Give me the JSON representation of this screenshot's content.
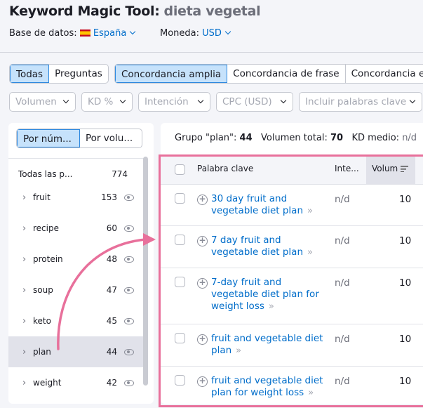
{
  "header": {
    "title": "Keyword Magic Tool:",
    "query": "dieta vegetal",
    "db_label": "Base de datos:",
    "db_value": "España",
    "currency_label": "Moneda:",
    "currency_value": "USD"
  },
  "tabs_type": [
    {
      "label": "Todas",
      "active": true
    },
    {
      "label": "Preguntas",
      "active": false
    }
  ],
  "tabs_match": [
    {
      "label": "Concordancia amplia",
      "active": true
    },
    {
      "label": "Concordancia de frase",
      "active": false
    },
    {
      "label": "Concordancia exacta",
      "active": false
    }
  ],
  "filters": [
    "Volumen",
    "KD %",
    "Intención",
    "CPC (USD)",
    "Incluir palabras clave"
  ],
  "groups": {
    "sort_tabs": [
      "Por núm...",
      "Por volu..."
    ],
    "all_label": "Todas las p...",
    "all_count": "774",
    "items": [
      {
        "name": "fruit",
        "count": "153"
      },
      {
        "name": "recipe",
        "count": "60"
      },
      {
        "name": "protein",
        "count": "48"
      },
      {
        "name": "soup",
        "count": "47"
      },
      {
        "name": "keto",
        "count": "45"
      },
      {
        "name": "plan",
        "count": "44",
        "selected": true
      },
      {
        "name": "weight",
        "count": "42"
      }
    ]
  },
  "summary": {
    "group_label": "Grupo \"plan\":",
    "group_count": "44",
    "total_label": "Volumen total:",
    "total_value": "70",
    "kd_label": "KD medio:",
    "kd_value": "n/d"
  },
  "table": {
    "headers": {
      "keyword": "Palabra clave",
      "intent": "Inte...",
      "volume": "Volum"
    },
    "rows": [
      {
        "keyword": "30 day fruit and vegetable diet plan",
        "intent": "n/d",
        "volume": "10"
      },
      {
        "keyword": "7 day fruit and vegetable diet plan",
        "intent": "n/d",
        "volume": "10"
      },
      {
        "keyword": "7-day fruit and vegetable diet plan for weight loss",
        "intent": "n/d",
        "volume": "10"
      },
      {
        "keyword": "fruit and vegetable diet plan",
        "intent": "n/d",
        "volume": "10"
      },
      {
        "keyword": "fruit and vegetable diet plan for weight loss",
        "intent": "n/d",
        "volume": "10"
      }
    ]
  },
  "colors": {
    "accent": "#006dca",
    "highlight": "#e8709b",
    "active_tab": "#c6e2fb"
  }
}
